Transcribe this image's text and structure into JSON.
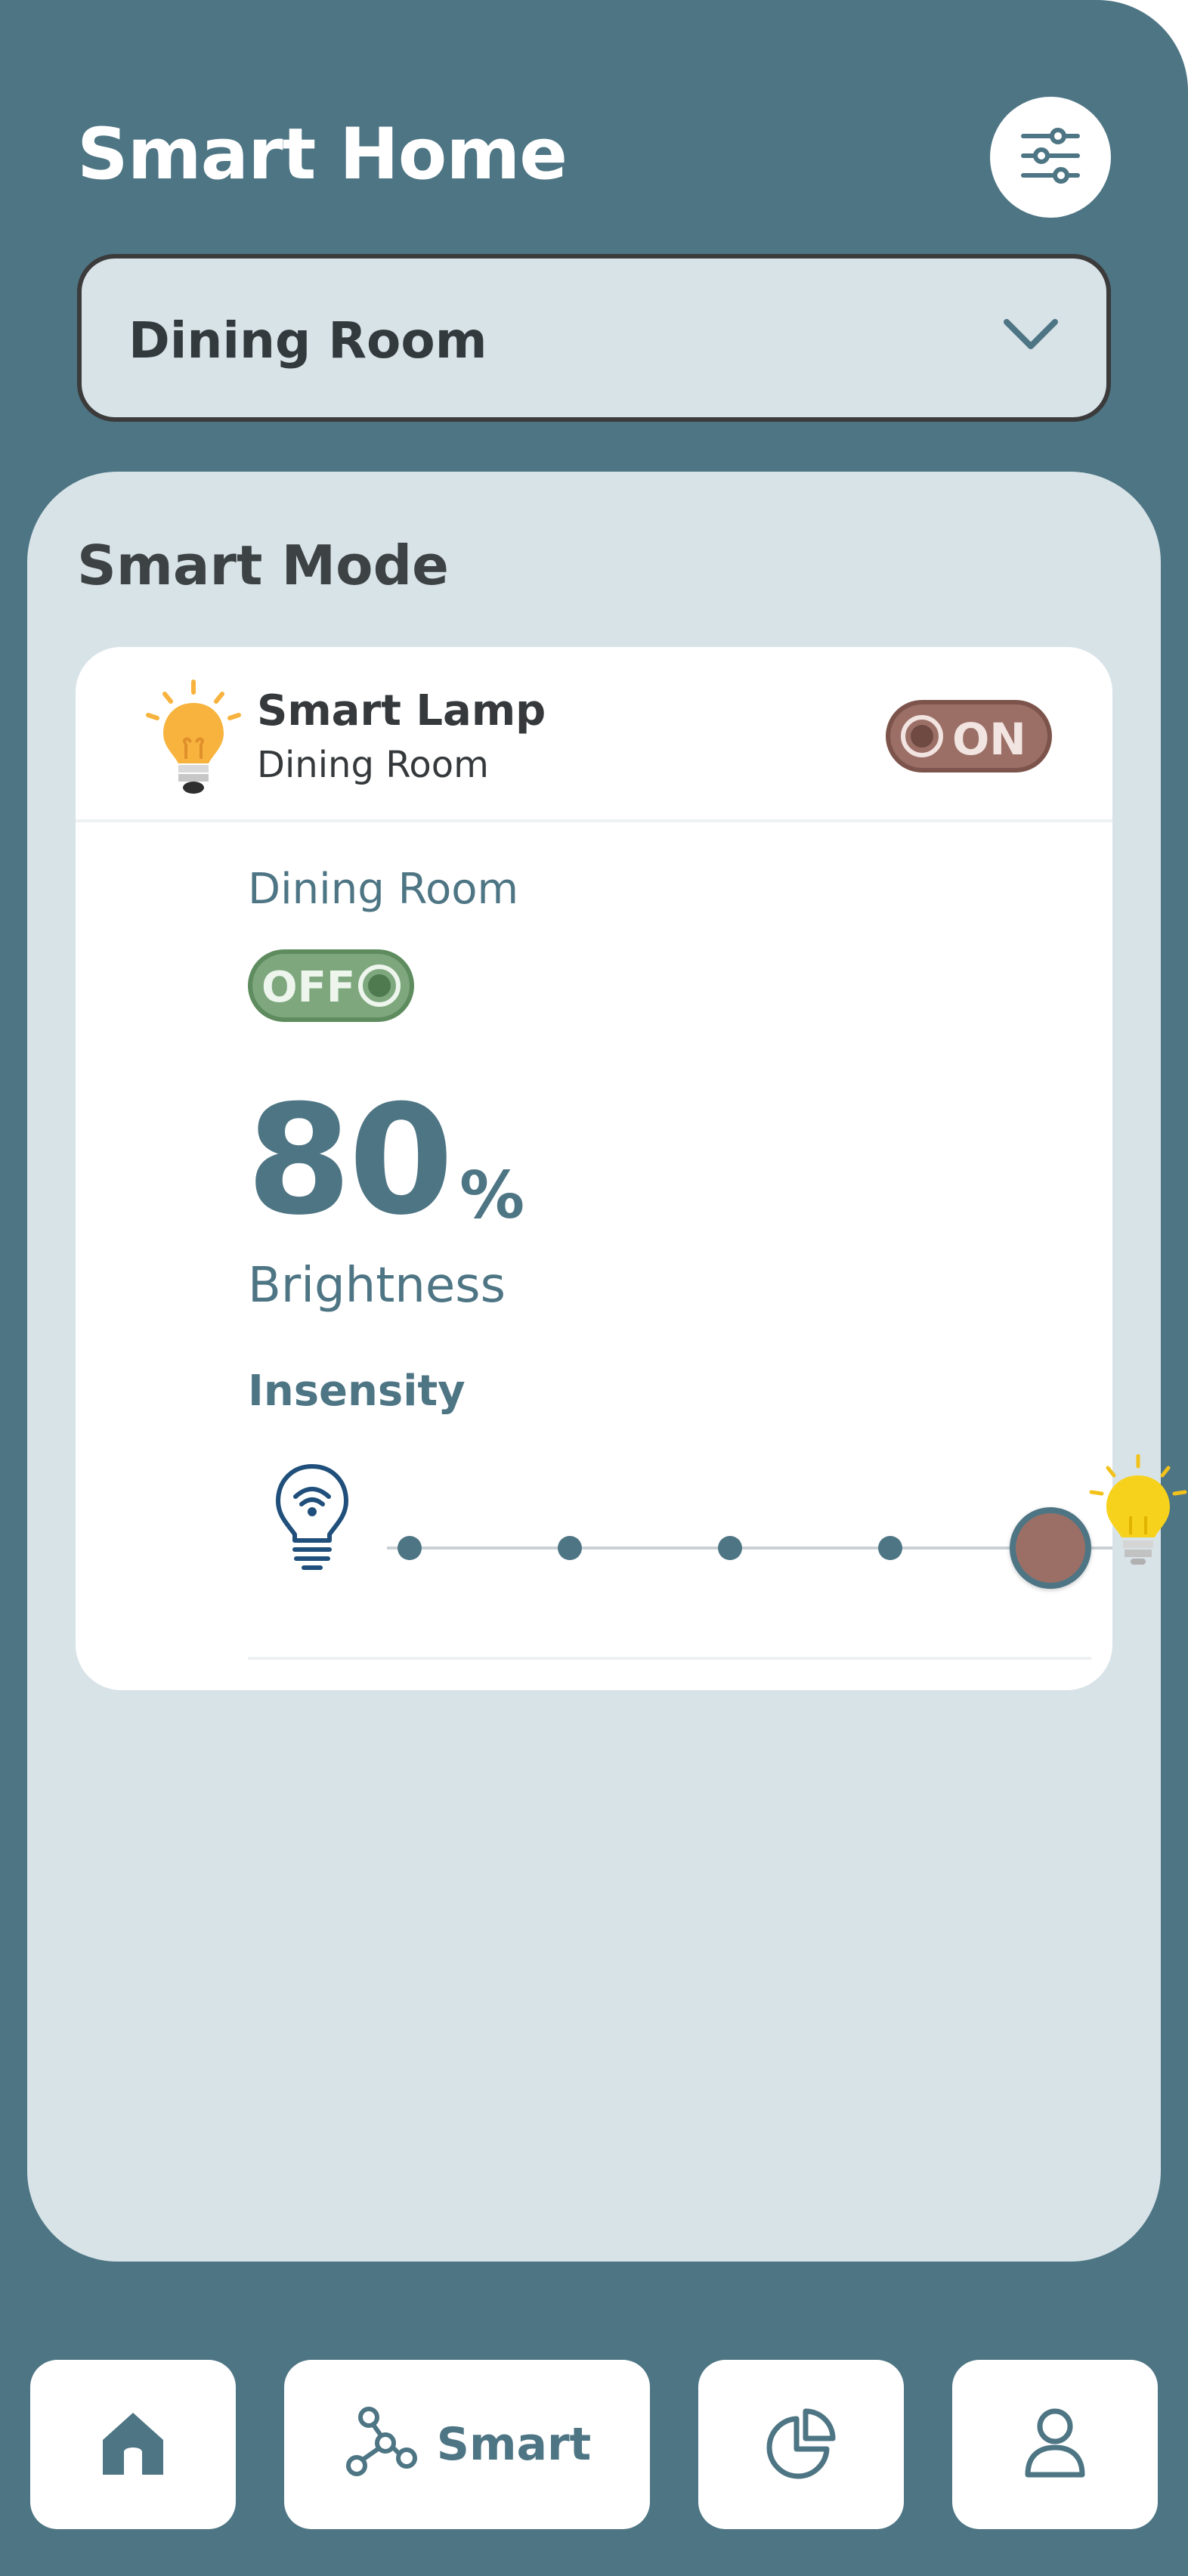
{
  "header": {
    "title": "Smart Home",
    "filter_icon": "sliders-icon"
  },
  "room_selector": {
    "selected": "Dining Room",
    "icon": "chevron-down-icon"
  },
  "panel": {
    "title": "Smart Mode"
  },
  "device": {
    "name": "Smart Lamp",
    "room": "Dining Room",
    "icon": "lamp-bulb-icon",
    "power_toggle_label": "ON"
  },
  "detail": {
    "room": "Dining Room",
    "toggle_label": "OFF",
    "brightness_value": "80",
    "brightness_unit": "%",
    "brightness_label": "Brightness",
    "intensity_label": "Insensity",
    "slider": {
      "stops": 6,
      "selected_index": 4
    }
  },
  "nav": {
    "home_icon": "home-icon",
    "smart_icon": "hub-icon",
    "smart_label": "Smart",
    "stats_icon": "pie-chart-icon",
    "profile_icon": "user-icon"
  },
  "colors": {
    "primary": "#4e7584",
    "panel": "#d8e3e8",
    "on_toggle": "#9b6f65",
    "off_toggle": "#7ea77e",
    "bulb": "#f7b33d"
  }
}
